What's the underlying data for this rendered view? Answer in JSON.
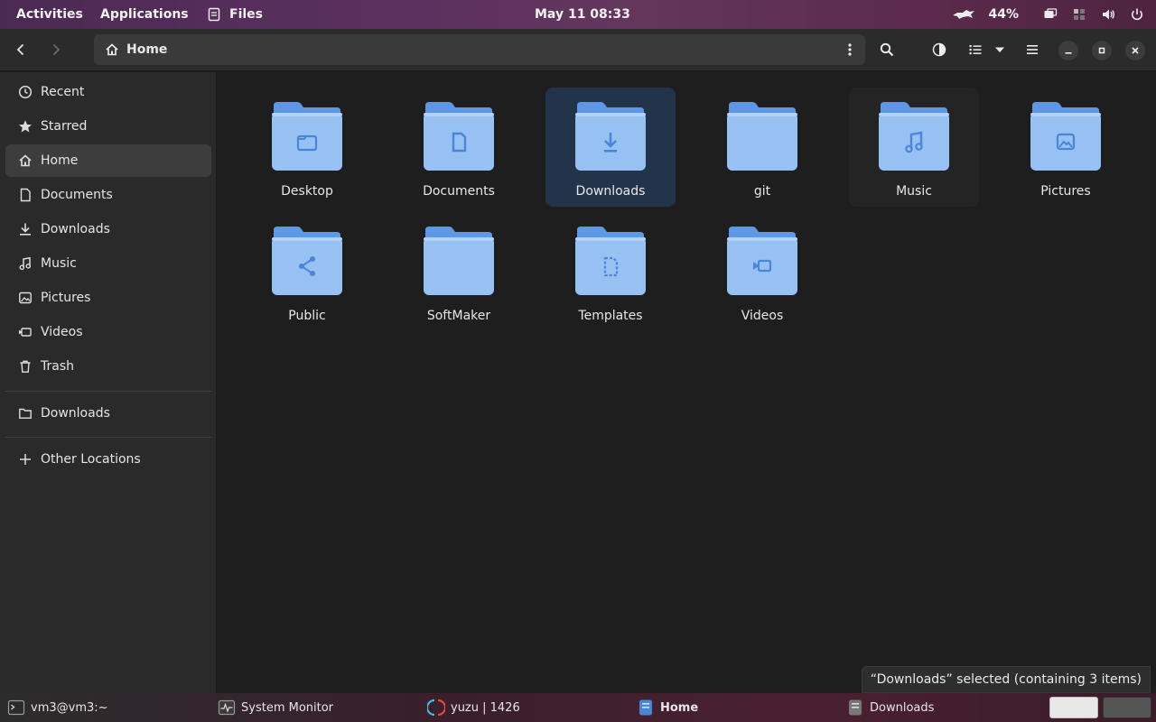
{
  "top_panel": {
    "activities": "Activities",
    "applications": "Applications",
    "app_name": "Files",
    "clock": "May 11  08:33",
    "battery_percent": "44%"
  },
  "headerbar": {
    "location": "Home"
  },
  "sidebar": {
    "items": [
      {
        "label": "Recent",
        "icon": "clock-icon"
      },
      {
        "label": "Starred",
        "icon": "star-icon"
      },
      {
        "label": "Home",
        "icon": "home-icon",
        "active": true
      },
      {
        "label": "Documents",
        "icon": "document-icon"
      },
      {
        "label": "Downloads",
        "icon": "download-icon"
      },
      {
        "label": "Music",
        "icon": "music-icon"
      },
      {
        "label": "Pictures",
        "icon": "picture-icon"
      },
      {
        "label": "Videos",
        "icon": "video-icon"
      },
      {
        "label": "Trash",
        "icon": "trash-icon"
      }
    ],
    "bookmarks": [
      {
        "label": "Downloads",
        "icon": "folder-icon"
      }
    ],
    "other_locations": "Other Locations"
  },
  "folders": [
    {
      "label": "Desktop",
      "emblem": "folder"
    },
    {
      "label": "Documents",
      "emblem": "document"
    },
    {
      "label": "Downloads",
      "emblem": "download",
      "selected": true
    },
    {
      "label": "git",
      "emblem": "none"
    },
    {
      "label": "Music",
      "emblem": "music"
    },
    {
      "label": "Pictures",
      "emblem": "picture"
    },
    {
      "label": "Public",
      "emblem": "share"
    },
    {
      "label": "SoftMaker",
      "emblem": "none"
    },
    {
      "label": "Templates",
      "emblem": "template"
    },
    {
      "label": "Videos",
      "emblem": "video"
    }
  ],
  "status": "“Downloads” selected  (containing 3 items)",
  "taskbar": {
    "items": [
      {
        "label": "vm3@vm3:~",
        "icon": "terminal-icon"
      },
      {
        "label": "System Monitor",
        "icon": "system-monitor-icon"
      },
      {
        "label": "yuzu | 1426",
        "icon": "yuzu-icon"
      },
      {
        "label": "Home",
        "icon": "files-icon",
        "active": true
      },
      {
        "label": "Downloads",
        "icon": "files-icon"
      }
    ]
  },
  "colors": {
    "folder_body": "#98c1f3",
    "folder_back": "#5d97e6",
    "emblem": "#4a86d8",
    "selection": "#22334a"
  }
}
